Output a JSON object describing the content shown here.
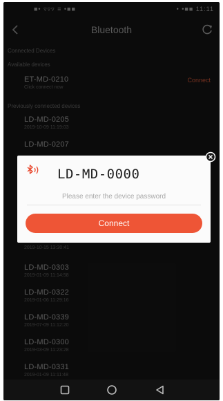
{
  "status_bar": {
    "left": "■• ▿▿▿ ≡ •■■",
    "right": "• •■■ 11:11"
  },
  "app_bar": {
    "title": "Bluetooth"
  },
  "sections": {
    "connected": "Connected Devices",
    "available": "Available devices",
    "previous": "Previously connected devices"
  },
  "available_devices": [
    {
      "name": "ET-MD-0210",
      "sub": "Click connect now",
      "action": "Connect"
    }
  ],
  "previous_devices": [
    {
      "name": "LD-MD-0205",
      "sub": "2019-10-09 11:19:03"
    },
    {
      "name": "LD-MD-0207",
      "sub": ""
    },
    {
      "name": "",
      "sub": "2019-10-15 13:30:41"
    },
    {
      "name": "LD-MD-0303",
      "sub": "2019-01-09 11:14:58"
    },
    {
      "name": "LD-MD-0322",
      "sub": "2019-01-06 11:29:16"
    },
    {
      "name": "LD-MD-0339",
      "sub": "2019-07-09 11:12:20"
    },
    {
      "name": "LD-MD-0300",
      "sub": "2019-03-09 11:23:28"
    },
    {
      "name": "LD-MD-0331",
      "sub": "2019-01-09 11:11:48"
    }
  ],
  "dialog": {
    "title": "LD-MD-0000",
    "password_placeholder": "Please enter the device password",
    "connect_label": "Connect",
    "accent": "#ee5536"
  },
  "icons": {
    "back": "chevron-left-icon",
    "refresh": "refresh-icon",
    "bluetooth": "bluetooth-icon",
    "close": "close-circle-icon",
    "nav_recent": "square-icon",
    "nav_home": "circle-icon",
    "nav_back": "triangle-back-icon"
  }
}
